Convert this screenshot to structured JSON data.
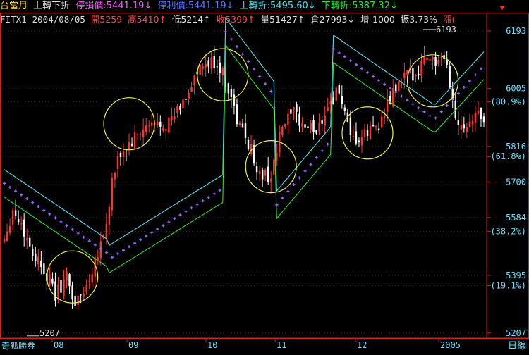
{
  "header": {
    "title": "台當月",
    "mode": "上轉下折",
    "stop_loss": "停損價:5441.19↓",
    "take_profit": "停利價:5441.19↓",
    "turn_up": "上轉折:5495.60↓",
    "turn_down": "下轉折:5387.32↓"
  },
  "quote": {
    "symbol": "FITX1",
    "date": "2004/08/05",
    "open": "開5259",
    "high": "高5410↑",
    "low": "低5214↑",
    "close": "收5399↑",
    "volume": "量51427↑",
    "open_interest": "倉27993↓",
    "oi_change": "增-1000",
    "amplitude": "振3.73%",
    "limit": "漲("
  },
  "footer": {
    "brand": "奇狐勝券",
    "period": "日線"
  },
  "colors": {
    "up": "#ff3333",
    "down": "#ffffff",
    "upper_band": "#55ddee",
    "lower_band": "#33dd33",
    "trail": "#9966ff",
    "circle": "#eeee44",
    "axis": "#cc2222",
    "label": "#66ddff"
  },
  "chart_data": {
    "type": "candlestick",
    "x_ticks": [
      "08",
      "09",
      "10",
      "11",
      "12",
      "2005"
    ],
    "y_ticks": [
      {
        "label": "6193",
        "value": 6193
      },
      {
        "label": "6005",
        "value": 6005
      },
      {
        "label": "(80.9%)",
        "value": 5962
      },
      {
        "label": "5816",
        "value": 5816
      },
      {
        "label": "(61.8%)",
        "value": 5783
      },
      {
        "label": "5700",
        "value": 5700
      },
      {
        "label": "5584",
        "value": 5584
      },
      {
        "label": "(38.2%)",
        "value": 5539
      },
      {
        "label": "5395",
        "value": 5395
      },
      {
        "label": "(19.1%)",
        "value": 5362
      },
      {
        "label": "5207",
        "value": 5207
      }
    ],
    "ylim": [
      5195,
      6225
    ],
    "annotations": [
      {
        "text": "6193",
        "value": 6193
      },
      {
        "text": "5207",
        "value": 5207
      }
    ],
    "circles": [
      {
        "day": 24,
        "price": 5390
      },
      {
        "day": 44,
        "price": 5890
      },
      {
        "day": 77,
        "price": 6050
      },
      {
        "day": 94,
        "price": 5750
      },
      {
        "day": 128,
        "price": 5860
      },
      {
        "day": 151,
        "price": 6030
      }
    ]
  }
}
